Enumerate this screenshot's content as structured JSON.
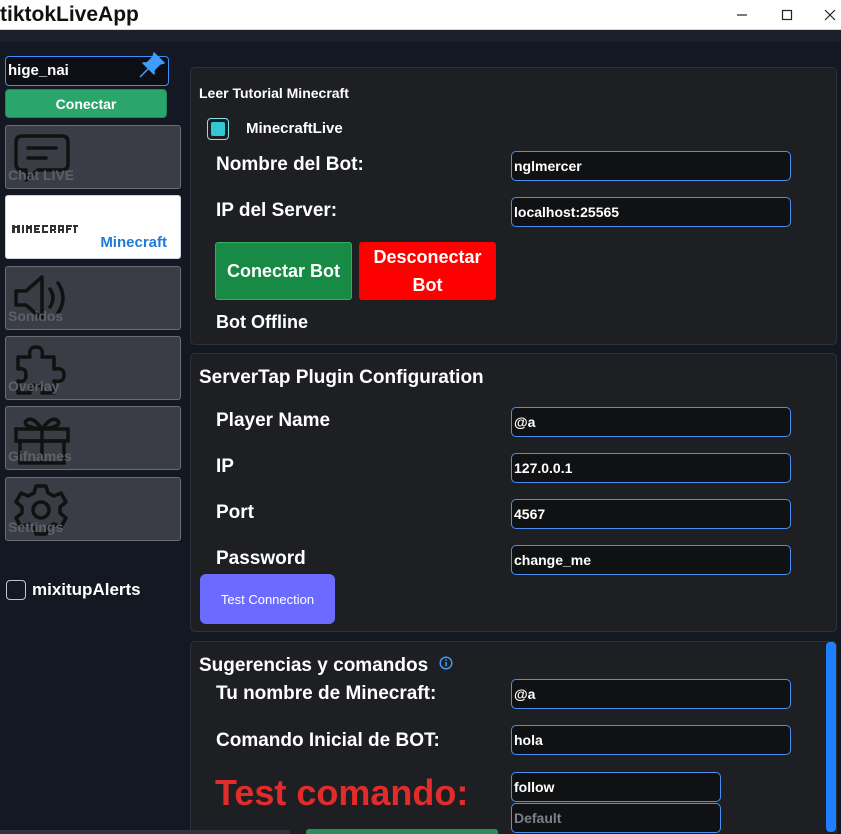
{
  "window": {
    "title": "tiktokLiveApp",
    "controls": [
      "minimize",
      "maximize",
      "close"
    ]
  },
  "sidebar": {
    "username_value": "hige_nai",
    "connect_label": "Conectar",
    "items": [
      {
        "label": "Chat LIVE",
        "icon": "chat-icon"
      },
      {
        "label": "Minecraft",
        "icon": "minecraft-logo",
        "active": true
      },
      {
        "label": "Sonidos",
        "icon": "speaker-icon"
      },
      {
        "label": "Overlay",
        "icon": "puzzle-icon"
      },
      {
        "label": "Gifnames",
        "icon": "gift-icon"
      },
      {
        "label": "Settings",
        "icon": "gear-icon"
      }
    ],
    "mixitup_label": "mixitupAlerts"
  },
  "minecraft_panel": {
    "tutorial_title": "Leer Tutorial Minecraft",
    "checkbox_label": "MinecraftLive",
    "checkbox_checked": true,
    "bot_name_label": "Nombre del Bot:",
    "bot_name_value": "nglmercer",
    "server_ip_label": "IP del Server:",
    "server_ip_value": "localhost:25565",
    "connect_bot_label": "Conectar Bot",
    "disconnect_bot_label": "Desconectar Bot",
    "status_text": "Bot Offline"
  },
  "servertap_panel": {
    "title": "ServerTap Plugin Configuration",
    "player_name_label": "Player Name",
    "player_name_value": "@a",
    "ip_label": "IP",
    "ip_value": "127.0.0.1",
    "port_label": "Port",
    "port_value": "4567",
    "password_label": "Password",
    "password_value": "change_me",
    "test_button_label": "Test Connection"
  },
  "commands_panel": {
    "title": "Sugerencias y comandos",
    "mc_name_label": "Tu nombre de Minecraft:",
    "mc_name_value": "@a",
    "initial_cmd_label": "Comando Inicial de BOT:",
    "initial_cmd_value": "hola",
    "test_label": "Test comando:",
    "test_value": "follow",
    "default_placeholder": "Default"
  },
  "colors": {
    "accent_blue": "#3f8cff",
    "connect_green": "#2aa56c",
    "bot_green": "#178a45",
    "disconnect_red": "#ff0000",
    "test_purple": "#6b6bff",
    "test_command_red": "#e22b2b",
    "checkbox_cyan": "#32c8d3"
  }
}
